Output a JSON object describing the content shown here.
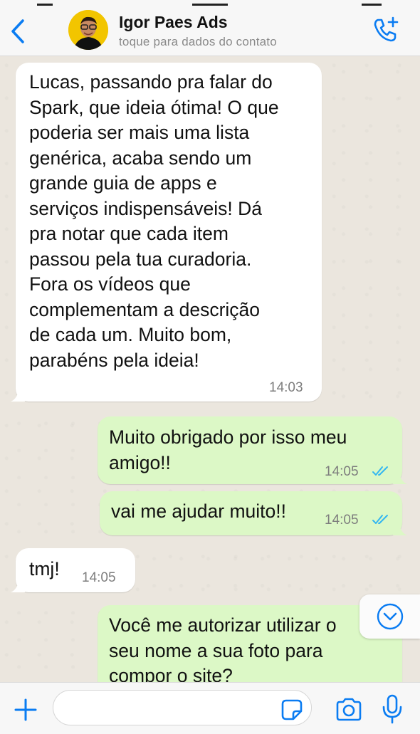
{
  "header": {
    "contact_name": "Igor Paes Ads",
    "contact_subtitle": "toque para dados do contato"
  },
  "colors": {
    "accent": "#0a7cf2",
    "incoming_bubble": "#ffffff",
    "outgoing_bubble": "#dcf8c6",
    "read_ticks": "#34b7f1"
  },
  "messages": [
    {
      "direction": "incoming",
      "text": "Lucas, passando pra falar do\nSpark, que ideia ótima! O que\npoderia ser mais uma lista\ngenérica, acaba sendo um\ngrande guia de apps e\nserviços indispensáveis! Dá\npra notar que cada item\npassou pela tua curadoria.\nFora os vídeos que\ncomplementam a descrição\nde cada um. Muito bom,\nparabéns pela ideia!",
      "time": "14:03"
    },
    {
      "direction": "outgoing",
      "text": "Muito obrigado por isso meu\namigo!!",
      "time": "14:05",
      "status": "read"
    },
    {
      "direction": "outgoing",
      "text": "vai me ajudar muito!!",
      "time": "14:05",
      "status": "read"
    },
    {
      "direction": "incoming",
      "text": "tmj!",
      "time": "14:05"
    },
    {
      "direction": "outgoing",
      "text": "Você me autorizar utilizar o\nseu nome a sua foto para\ncompor o site?",
      "time": ""
    }
  ],
  "icons": {
    "back": "chevron-left-icon",
    "call": "phone-plus-icon",
    "scroll_down": "chevron-down-circle-icon",
    "attach": "plus-icon",
    "sticker": "sticker-icon",
    "camera": "camera-icon",
    "mic": "microphone-icon"
  }
}
